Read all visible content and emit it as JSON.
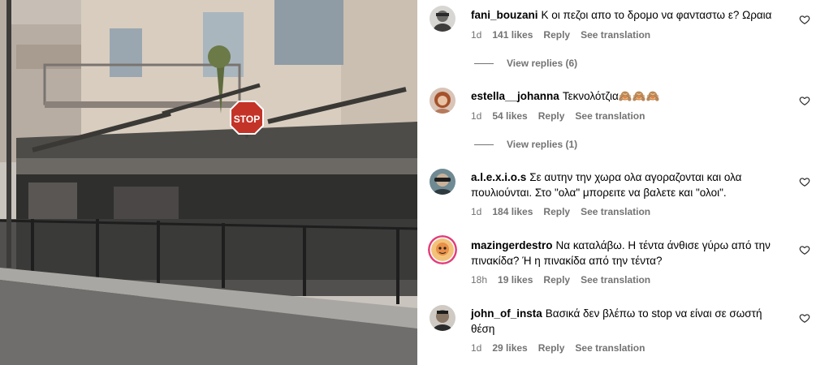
{
  "photo": {
    "stop_sign_text": "STOP"
  },
  "comments": [
    {
      "username": "fani_bouzani",
      "text": "Κ οι πεζοι απο το δρομο να φανταστω ε? Ωραια",
      "time": "1d",
      "likes": "141 likes",
      "reply": "Reply",
      "translate": "See translation",
      "view_replies": "View replies (6)"
    },
    {
      "username": "estella__johanna",
      "text": "Τεκνολότζια🙈🙈🙈",
      "time": "1d",
      "likes": "54 likes",
      "reply": "Reply",
      "translate": "See translation",
      "view_replies": "View replies (1)"
    },
    {
      "username": "a.l.e.x.i.o.s",
      "text": "Σε αυτην την χωρα ολα αγοραζονται και ολα πουλιούνται. Στο \"ολα\" μπορειτε να βαλετε και \"ολοι\".",
      "time": "1d",
      "likes": "184 likes",
      "reply": "Reply",
      "translate": "See translation"
    },
    {
      "username": "mazingerdestro",
      "text": "Να καταλάβω. Η τέντα άνθισε γύρω από την πινακίδα? Ή η πινακίδα από την τέντα?",
      "time": "18h",
      "likes": "19 likes",
      "reply": "Reply",
      "translate": "See translation"
    },
    {
      "username": "john_of_insta",
      "text": "Βασικά δεν βλέπω το stop να είναι σε σωστή θέση",
      "time": "1d",
      "likes": "29 likes",
      "reply": "Reply",
      "translate": "See translation"
    }
  ]
}
